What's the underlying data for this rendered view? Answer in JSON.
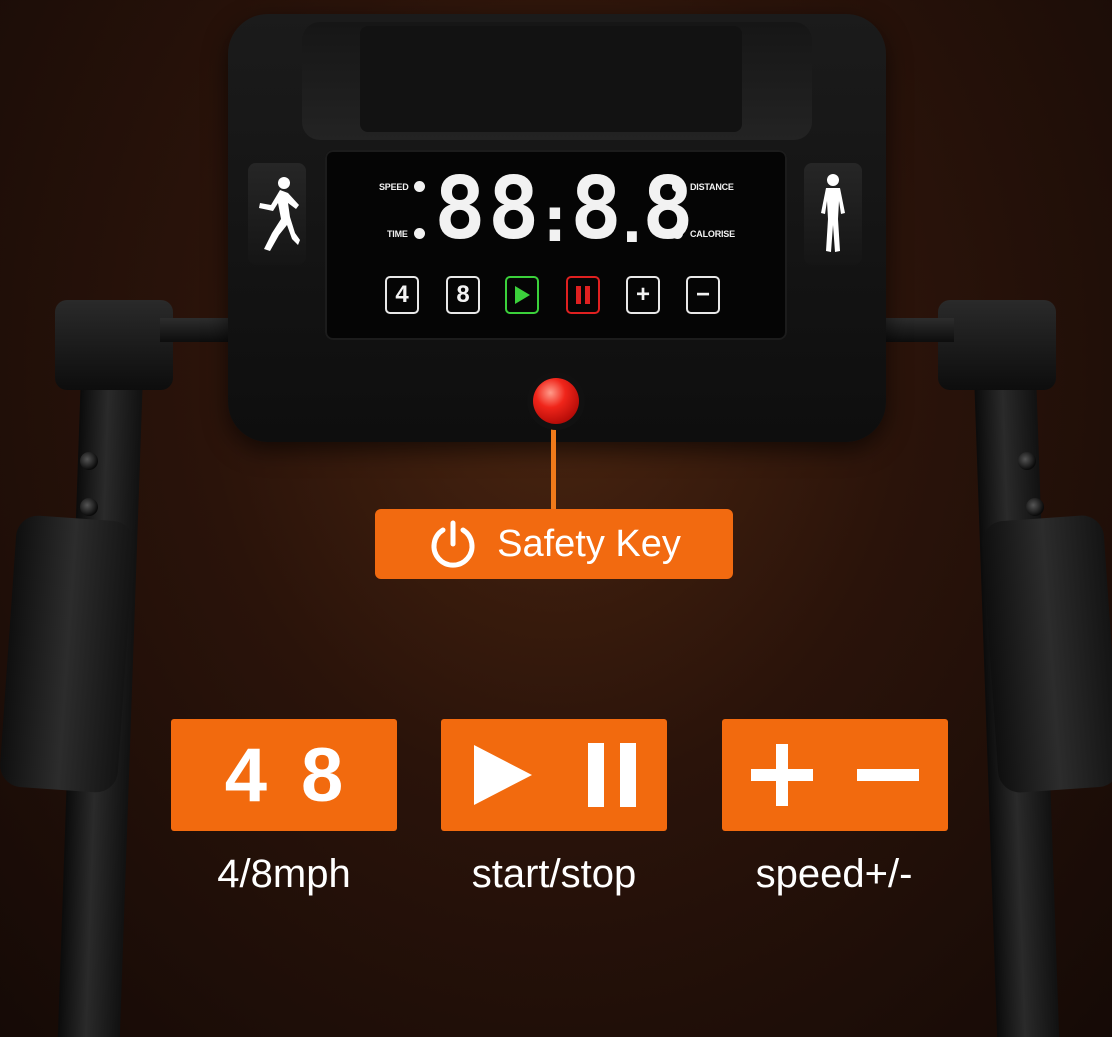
{
  "lcd": {
    "speed_label": "SPEED",
    "time_label": "TIME",
    "distance_label": "DISTANCE",
    "calorise_label": "CALORISE",
    "readout": "8888",
    "buttons": [
      "4",
      "8",
      "play",
      "pause",
      "+",
      "−"
    ]
  },
  "safety": {
    "label": "Safety Key"
  },
  "controls": [
    {
      "top": "4 8",
      "caption": "4/8mph"
    },
    {
      "top": "play-pause",
      "caption": "start/stop"
    },
    {
      "top": "+ −",
      "caption": "speed+/-"
    }
  ],
  "colors": {
    "accent": "#f26a0e",
    "play": "#3bd13b",
    "pause": "#e02020",
    "safety_ball": "#f0251a"
  },
  "icons": [
    "runner-icon",
    "walker-icon",
    "power-icon",
    "play-icon",
    "pause-icon",
    "plus-icon",
    "minus-icon"
  ]
}
